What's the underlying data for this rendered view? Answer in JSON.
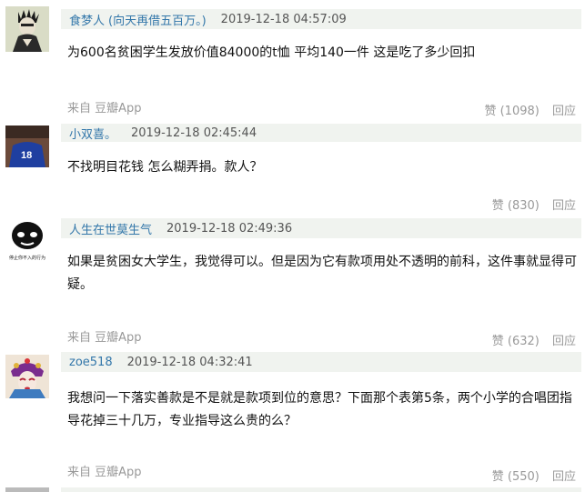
{
  "comments": [
    {
      "author": "食梦人",
      "signature": "(向天再借五百万。)",
      "time": "2019-12-18 04:57:09",
      "content": "为600名贫困学生发放价值84000的t恤 平均140一件 这是吃了多少回扣",
      "source": "来自 豆瓣App",
      "like_label": "赞 (1098)",
      "reply_label": "回应"
    },
    {
      "author": "小双喜。",
      "time": "2019-12-18 02:45:44",
      "content": "不找明目花钱 怎么糊弄捐。款人？",
      "like_label": "赞 (830)",
      "reply_label": "回应"
    },
    {
      "author": "人生在世莫生气",
      "time": "2019-12-18 02:49:36",
      "content": "如果是贫困女大学生，我觉得可以。但是因为它有款项用处不透明的前科，这件事就显得可疑。",
      "source": "来自 豆瓣App",
      "like_label": "赞 (632)",
      "reply_label": "回应"
    },
    {
      "author": "zoe518",
      "time": "2019-12-18 04:32:41",
      "content": "我想问一下落实善款是不是就是款项到位的意思？下面那个表第5条，两个小学的合唱团指导花掉三十几万，专业指导这么贵的么？",
      "source": "来自 豆瓣App",
      "like_label": "赞 (550)",
      "reply_label": "回应"
    }
  ],
  "avatar_caption_3": "停止你不入的行为"
}
